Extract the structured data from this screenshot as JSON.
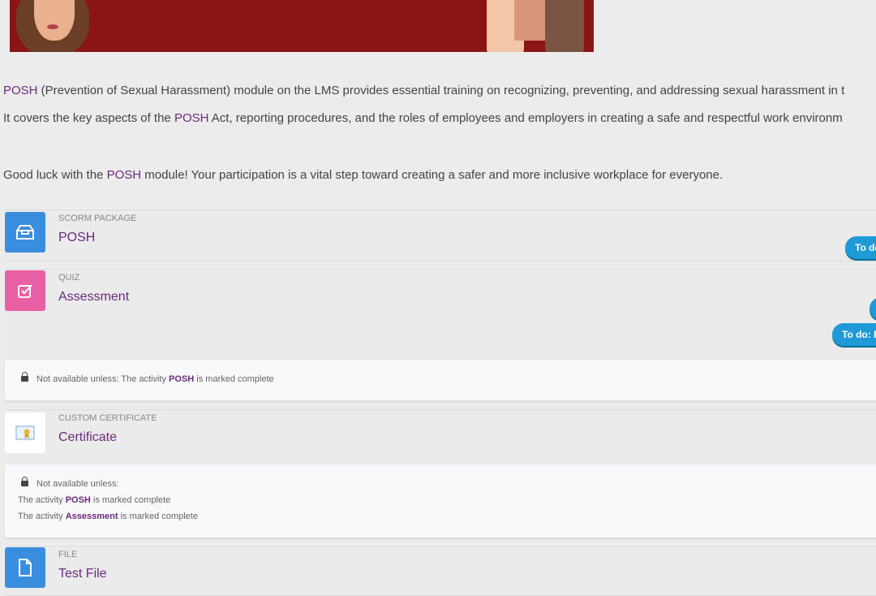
{
  "description": {
    "p1_highlight": "POSH",
    "p1_rest": " (Prevention of Sexual Harassment) module on the LMS provides essential training on recognizing, preventing, and addressing sexual harassment in t",
    "p2_before": "It covers the key aspects of the ",
    "p2_highlight": "POSH",
    "p2_after": " Act, reporting procedures, and the roles of employees and employers in creating a safe and respectful work environm",
    "p3_before": "Good luck with the ",
    "p3_highlight": "POSH",
    "p3_after": " module! Your participation is a vital step toward creating a safer and more inclusive workplace for everyone."
  },
  "activities": [
    {
      "type": "SCORM PACKAGE",
      "name": "POSH",
      "icon": "package-icon",
      "icon_color": "#3a8ee0",
      "todo": "To do"
    },
    {
      "type": "QUIZ",
      "name": "Assessment",
      "icon": "checkbox-icon",
      "icon_color": "#e85fa4",
      "todo": "To do: P",
      "restriction": {
        "prefix": "Not available unless: The activity ",
        "activity": "POSH",
        "suffix": " is marked complete"
      }
    },
    {
      "type": "CUSTOM CERTIFICATE",
      "name": "Certificate",
      "icon": "certificate-icon",
      "restriction": {
        "header": "Not available unless:",
        "line1_prefix": "The activity ",
        "line1_activity": "POSH",
        "line1_suffix": " is marked complete",
        "line2_prefix": "The activity ",
        "line2_activity": "Assessment",
        "line2_suffix": " is marked complete"
      }
    },
    {
      "type": "FILE",
      "name": "Test File",
      "icon": "file-icon",
      "icon_color": "#3a8ee0"
    }
  ]
}
